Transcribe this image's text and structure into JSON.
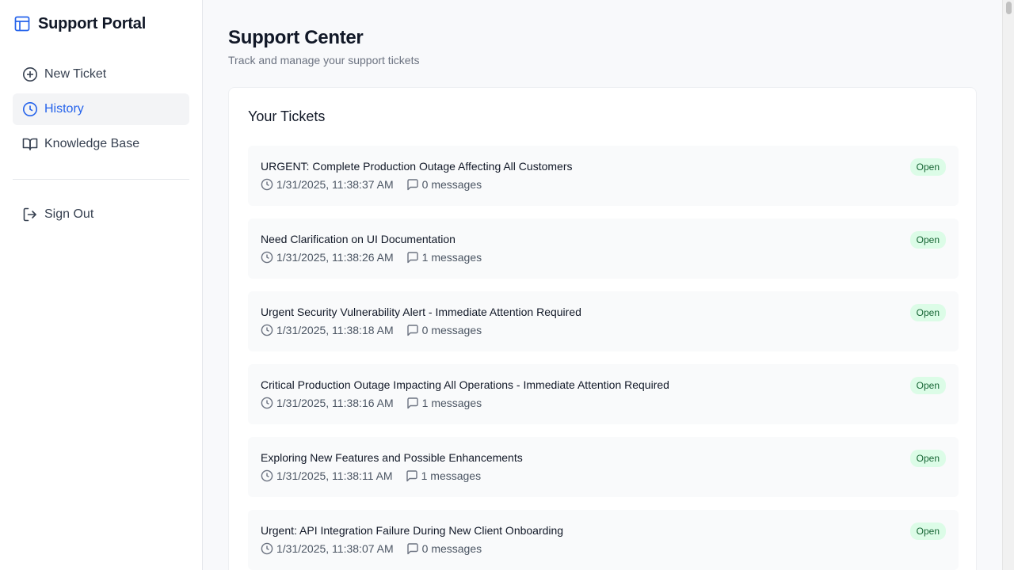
{
  "sidebar": {
    "brand": {
      "title": "Support Portal",
      "icon": "layout-icon"
    },
    "nav": [
      {
        "label": "New Ticket",
        "icon": "plus-circle-icon",
        "active": false
      },
      {
        "label": "History",
        "icon": "clock-icon",
        "active": true
      },
      {
        "label": "Knowledge Base",
        "icon": "book-open-icon",
        "active": false
      }
    ],
    "signout": {
      "label": "Sign Out",
      "icon": "log-out-icon"
    }
  },
  "main": {
    "title": "Support Center",
    "subtitle": "Track and manage your support tickets",
    "card_title": "Your Tickets",
    "tickets": [
      {
        "title": "URGENT: Complete Production Outage Affecting All Customers",
        "timestamp": "1/31/2025, 11:38:37 AM",
        "messages": "0 messages",
        "status": "Open"
      },
      {
        "title": "Need Clarification on UI Documentation",
        "timestamp": "1/31/2025, 11:38:26 AM",
        "messages": "1 messages",
        "status": "Open"
      },
      {
        "title": "Urgent Security Vulnerability Alert - Immediate Attention Required",
        "timestamp": "1/31/2025, 11:38:18 AM",
        "messages": "0 messages",
        "status": "Open"
      },
      {
        "title": "Critical Production Outage Impacting All Operations - Immediate Attention Required",
        "timestamp": "1/31/2025, 11:38:16 AM",
        "messages": "1 messages",
        "status": "Open"
      },
      {
        "title": "Exploring New Features and Possible Enhancements",
        "timestamp": "1/31/2025, 11:38:11 AM",
        "messages": "1 messages",
        "status": "Open"
      },
      {
        "title": "Urgent: API Integration Failure During New Client Onboarding",
        "timestamp": "1/31/2025, 11:38:07 AM",
        "messages": "0 messages",
        "status": "Open"
      }
    ]
  },
  "colors": {
    "accent": "#2563eb",
    "badge_bg": "#dcfce7",
    "badge_text": "#166534"
  }
}
